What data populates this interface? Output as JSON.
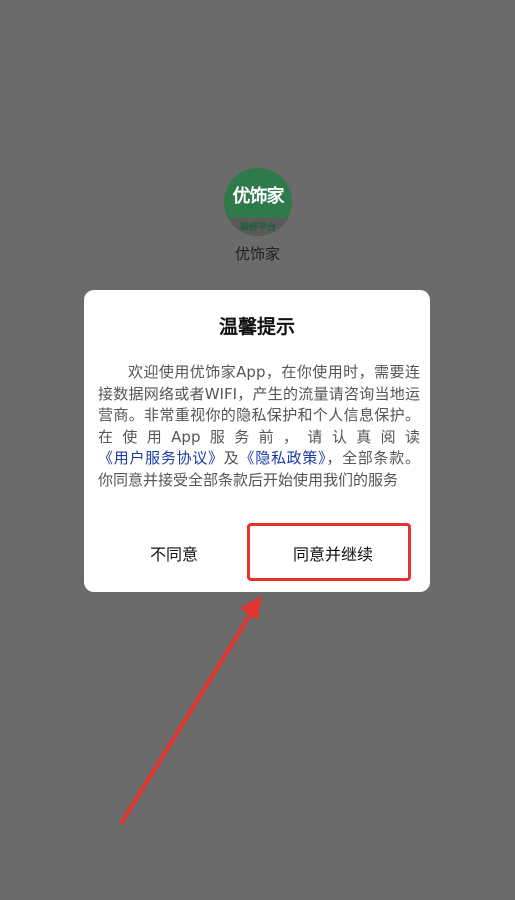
{
  "app": {
    "name": "优饰家",
    "logo_text": "优饰家",
    "logo_sub": "装修平台"
  },
  "dialog": {
    "title": "温馨提示",
    "body_part1": "欢迎使用优饰家App，在你使用时，需要连接数据网络或者WIFI，产生的流量请咨询当地运营商。非常重视你的隐私保护和个人信息保护。在使用App服务前，请认真阅读",
    "link_user_agreement": "《用户服务协议》",
    "body_and": "及",
    "link_privacy_policy": "《隐私政策》",
    "body_part2": "，全部条款。你同意并接受全部条款后开始使用我们的服务",
    "disagree_label": "不同意",
    "agree_label": "同意并继续"
  },
  "colors": {
    "overlay": "#6b6b6b",
    "link": "#1a3aa8",
    "annotation": "#e5332e",
    "logo_green": "#2f7a4a"
  }
}
